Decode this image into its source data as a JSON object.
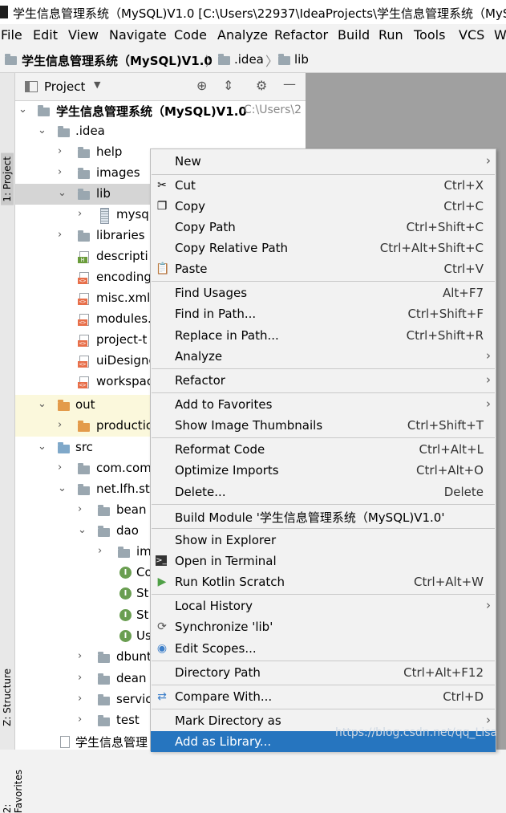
{
  "window": {
    "title": "学生信息管理系统（MySQL)V1.0 [C:\\Users\\22937\\IdeaProjects\\学生信息管理系统（MyS"
  },
  "menubar": [
    "File",
    "Edit",
    "View",
    "Navigate",
    "Code",
    "Analyze",
    "Refactor",
    "Build",
    "Run",
    "Tools",
    "VCS",
    "W"
  ],
  "breadcrumb": {
    "project": "学生信息管理系统（MySQL)V1.0",
    "idea": ".idea",
    "lib": "lib"
  },
  "side_tabs": {
    "project": "1: Project",
    "structure": "Z: Structure",
    "favorites": "2: Favorites"
  },
  "project_panel": {
    "title": "Project",
    "tree": [
      {
        "label": "学生信息管理系统（MySQL)V1.0",
        "sub": "C:\\Users\\2"
      },
      {
        "label": ".idea"
      },
      {
        "label": "help"
      },
      {
        "label": "images"
      },
      {
        "label": "lib"
      },
      {
        "label": "mysql"
      },
      {
        "label": "libraries"
      },
      {
        "label": "descripti"
      },
      {
        "label": "encoding"
      },
      {
        "label": "misc.xml"
      },
      {
        "label": "modules."
      },
      {
        "label": "project-t"
      },
      {
        "label": "uiDesigne"
      },
      {
        "label": "workspac"
      },
      {
        "label": "out"
      },
      {
        "label": "productio"
      },
      {
        "label": "src"
      },
      {
        "label": "com.com"
      },
      {
        "label": "net.lfh.stu"
      },
      {
        "label": "bean"
      },
      {
        "label": "dao"
      },
      {
        "label": "im"
      },
      {
        "label": "Co"
      },
      {
        "label": "St"
      },
      {
        "label": "St"
      },
      {
        "label": "Us"
      },
      {
        "label": "dbunt"
      },
      {
        "label": "dean"
      },
      {
        "label": "servic"
      },
      {
        "label": "test"
      },
      {
        "label": "学生信息管理"
      }
    ]
  },
  "context_menu": [
    {
      "label": "New",
      "key": "",
      "sub": true
    },
    {
      "label": "Cut",
      "key": "Ctrl+X"
    },
    {
      "label": "Copy",
      "key": "Ctrl+C"
    },
    {
      "label": "Copy Path",
      "key": "Ctrl+Shift+C"
    },
    {
      "label": "Copy Relative Path",
      "key": "Ctrl+Alt+Shift+C"
    },
    {
      "label": "Paste",
      "key": "Ctrl+V"
    },
    {
      "label": "Find Usages",
      "key": "Alt+F7"
    },
    {
      "label": "Find in Path...",
      "key": "Ctrl+Shift+F"
    },
    {
      "label": "Replace in Path...",
      "key": "Ctrl+Shift+R"
    },
    {
      "label": "Analyze",
      "key": "",
      "sub": true
    },
    {
      "label": "Refactor",
      "key": "",
      "sub": true
    },
    {
      "label": "Add to Favorites",
      "key": "",
      "sub": true
    },
    {
      "label": "Show Image Thumbnails",
      "key": "Ctrl+Shift+T"
    },
    {
      "label": "Reformat Code",
      "key": "Ctrl+Alt+L"
    },
    {
      "label": "Optimize Imports",
      "key": "Ctrl+Alt+O"
    },
    {
      "label": "Delete...",
      "key": "Delete"
    },
    {
      "label": "Build Module '学生信息管理系统（MySQL)V1.0'",
      "key": ""
    },
    {
      "label": "Show in Explorer",
      "key": ""
    },
    {
      "label": "Open in Terminal",
      "key": ""
    },
    {
      "label": "Run Kotlin Scratch",
      "key": "Ctrl+Alt+W"
    },
    {
      "label": "Local History",
      "key": "",
      "sub": true
    },
    {
      "label": "Synchronize 'lib'",
      "key": ""
    },
    {
      "label": "Edit Scopes...",
      "key": ""
    },
    {
      "label": "Directory Path",
      "key": "Ctrl+Alt+F12"
    },
    {
      "label": "Compare With...",
      "key": "Ctrl+D"
    },
    {
      "label": "Mark Directory as",
      "key": "",
      "sub": true
    },
    {
      "label": "Add as Library...",
      "key": ""
    }
  ],
  "watermark": "https://blog.csdn.net/qq_Lisa"
}
